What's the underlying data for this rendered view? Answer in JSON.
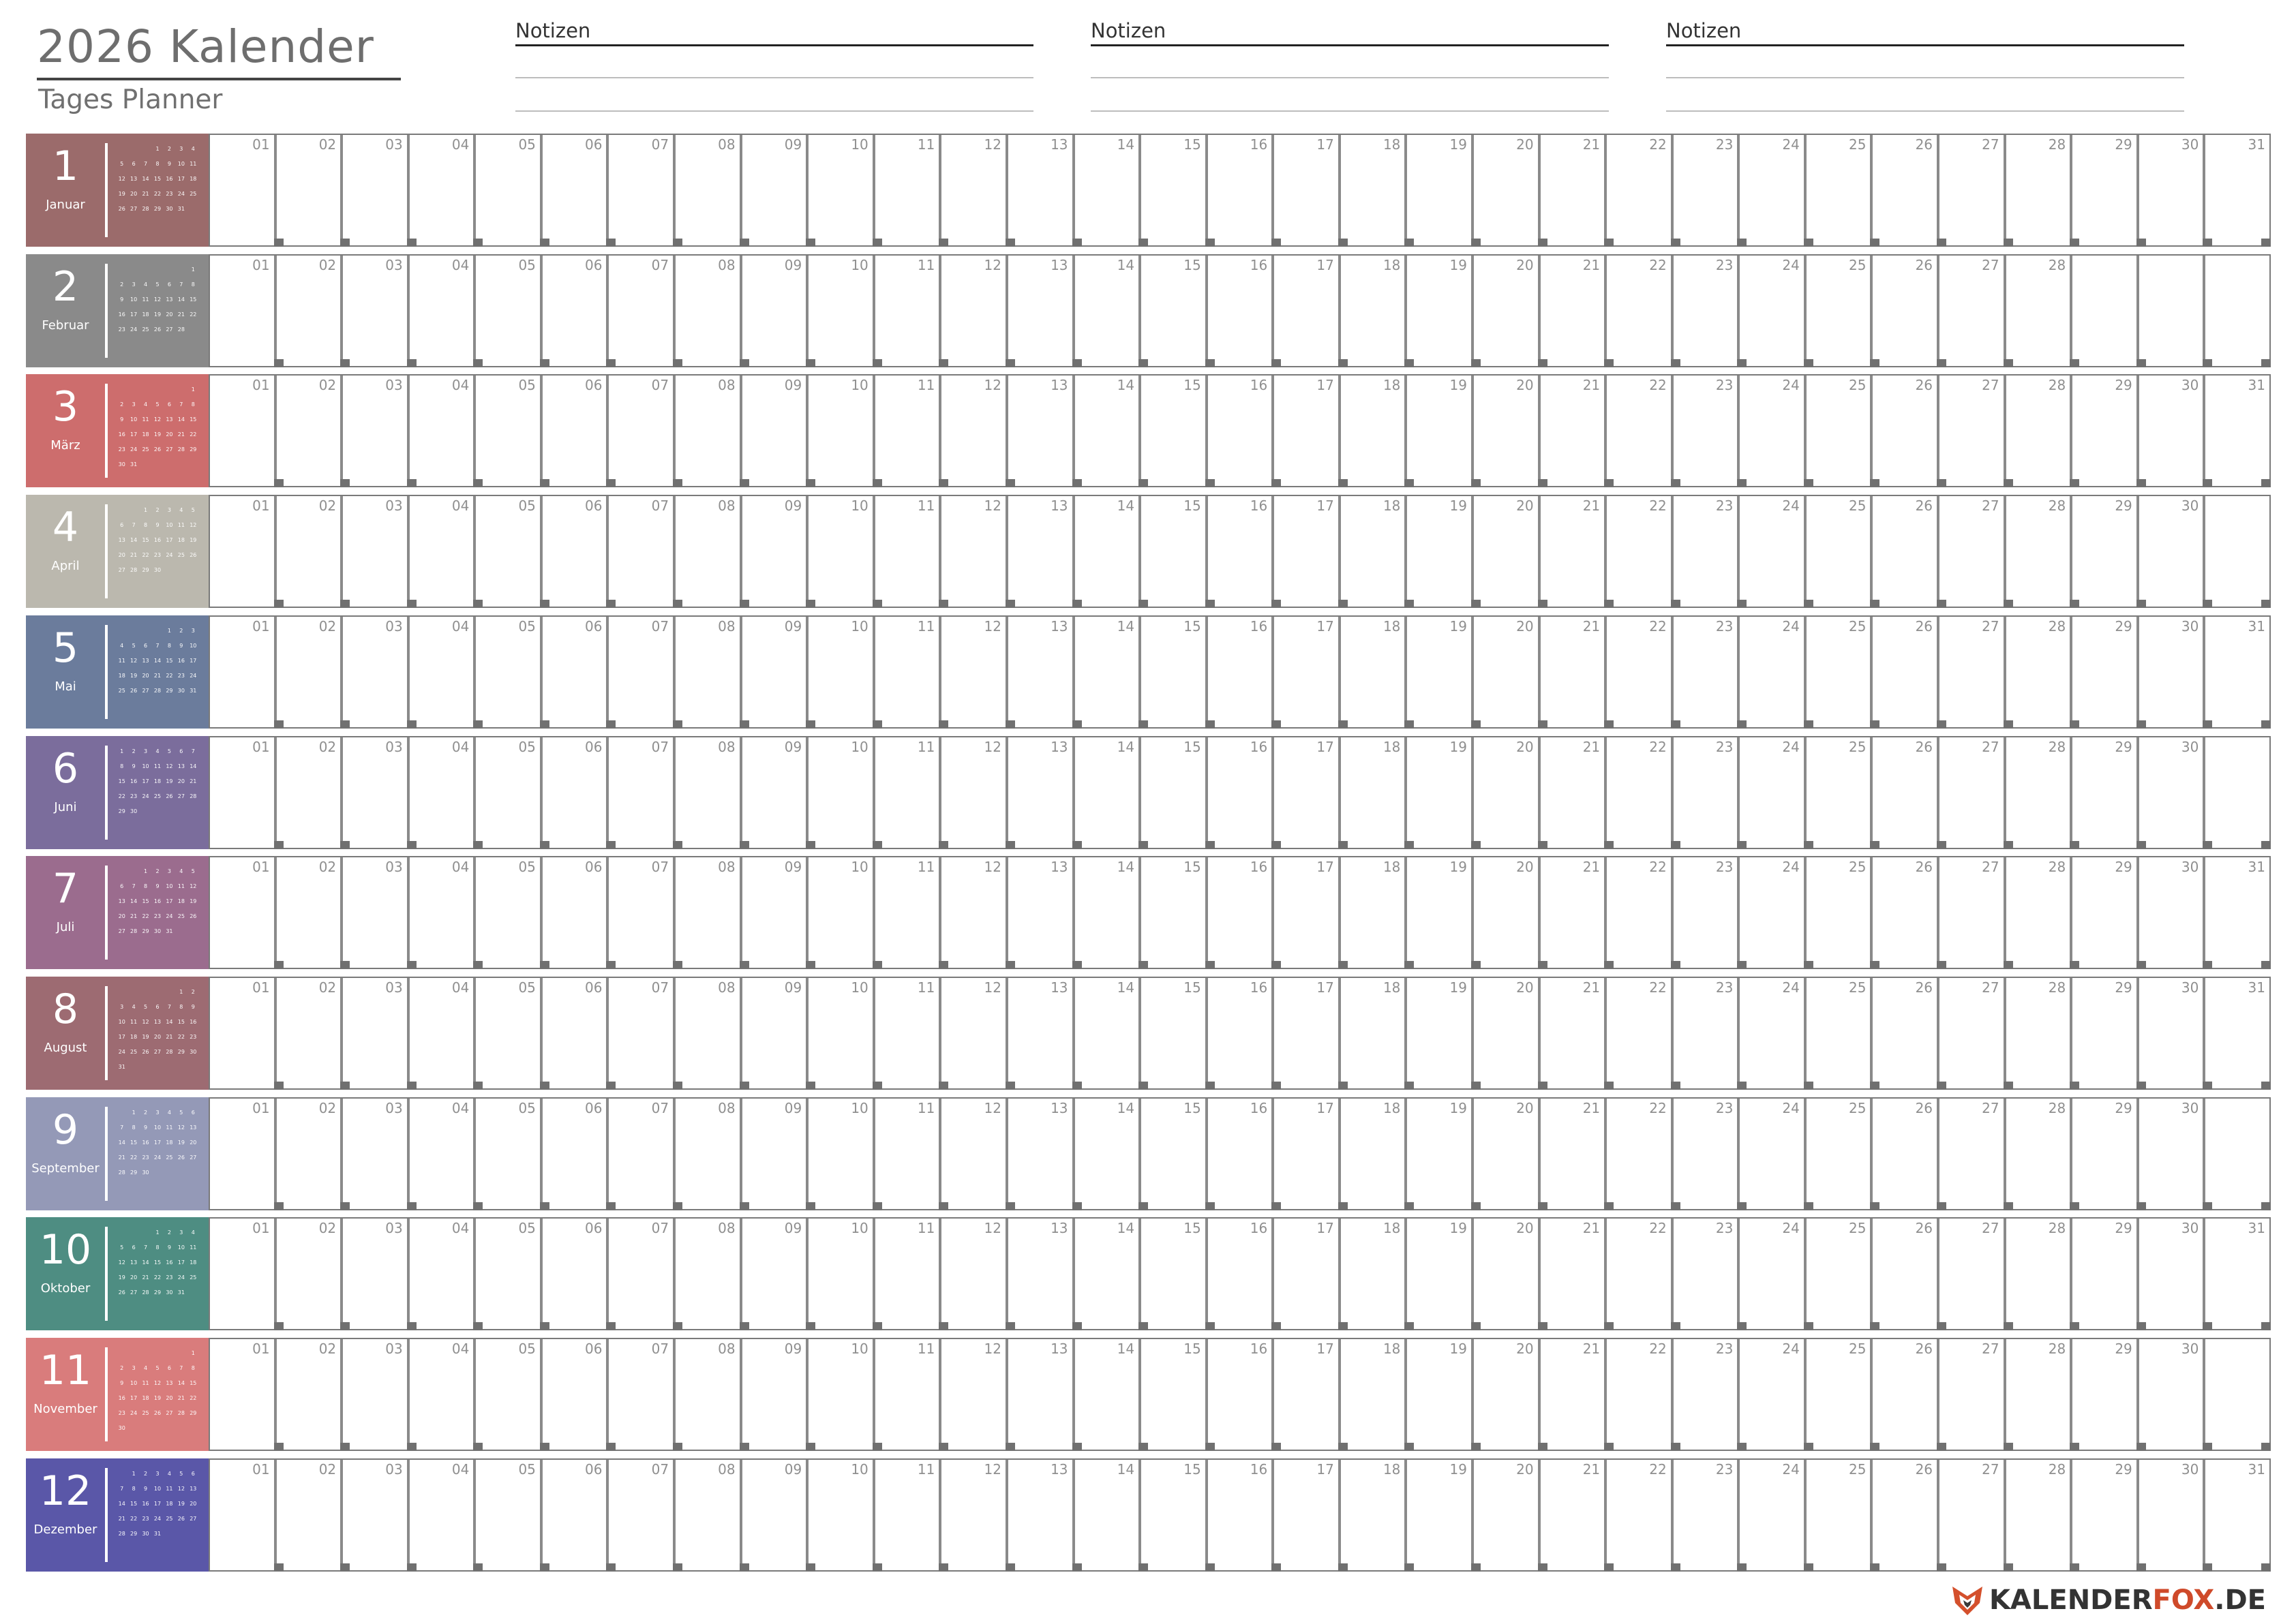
{
  "header": {
    "title": "2026 Kalender",
    "subtitle": "Tages Planner",
    "notes": [
      "Notizen",
      "Notizen",
      "Notizen"
    ]
  },
  "weekday_start": "monday",
  "months": [
    {
      "num": "1",
      "name": "Januar",
      "days": 31,
      "first_weekday": 4,
      "color": "#9b6b6b"
    },
    {
      "num": "2",
      "name": "Februar",
      "days": 28,
      "first_weekday": 7,
      "color": "#8a8a8a"
    },
    {
      "num": "3",
      "name": "März",
      "days": 31,
      "first_weekday": 7,
      "color": "#cd6d6d"
    },
    {
      "num": "4",
      "name": "April",
      "days": 30,
      "first_weekday": 3,
      "color": "#bbb8ae"
    },
    {
      "num": "5",
      "name": "Mai",
      "days": 31,
      "first_weekday": 5,
      "color": "#6b7c9c"
    },
    {
      "num": "6",
      "name": "Juni",
      "days": 30,
      "first_weekday": 1,
      "color": "#7b6d9c"
    },
    {
      "num": "7",
      "name": "Juli",
      "days": 31,
      "first_weekday": 3,
      "color": "#9b6c8e"
    },
    {
      "num": "8",
      "name": "August",
      "days": 31,
      "first_weekday": 6,
      "color": "#9d6b72"
    },
    {
      "num": "9",
      "name": "September",
      "days": 30,
      "first_weekday": 2,
      "color": "#9499b7"
    },
    {
      "num": "10",
      "name": "Oktober",
      "days": 31,
      "first_weekday": 4,
      "color": "#4e8d82"
    },
    {
      "num": "11",
      "name": "November",
      "days": 30,
      "first_weekday": 7,
      "color": "#d97c7c"
    },
    {
      "num": "12",
      "name": "Dezember",
      "days": 31,
      "first_weekday": 2,
      "color": "#5a57a8"
    }
  ],
  "brand": {
    "main": "KALENDER",
    "accent": "FOX",
    "suffix": ".DE"
  }
}
